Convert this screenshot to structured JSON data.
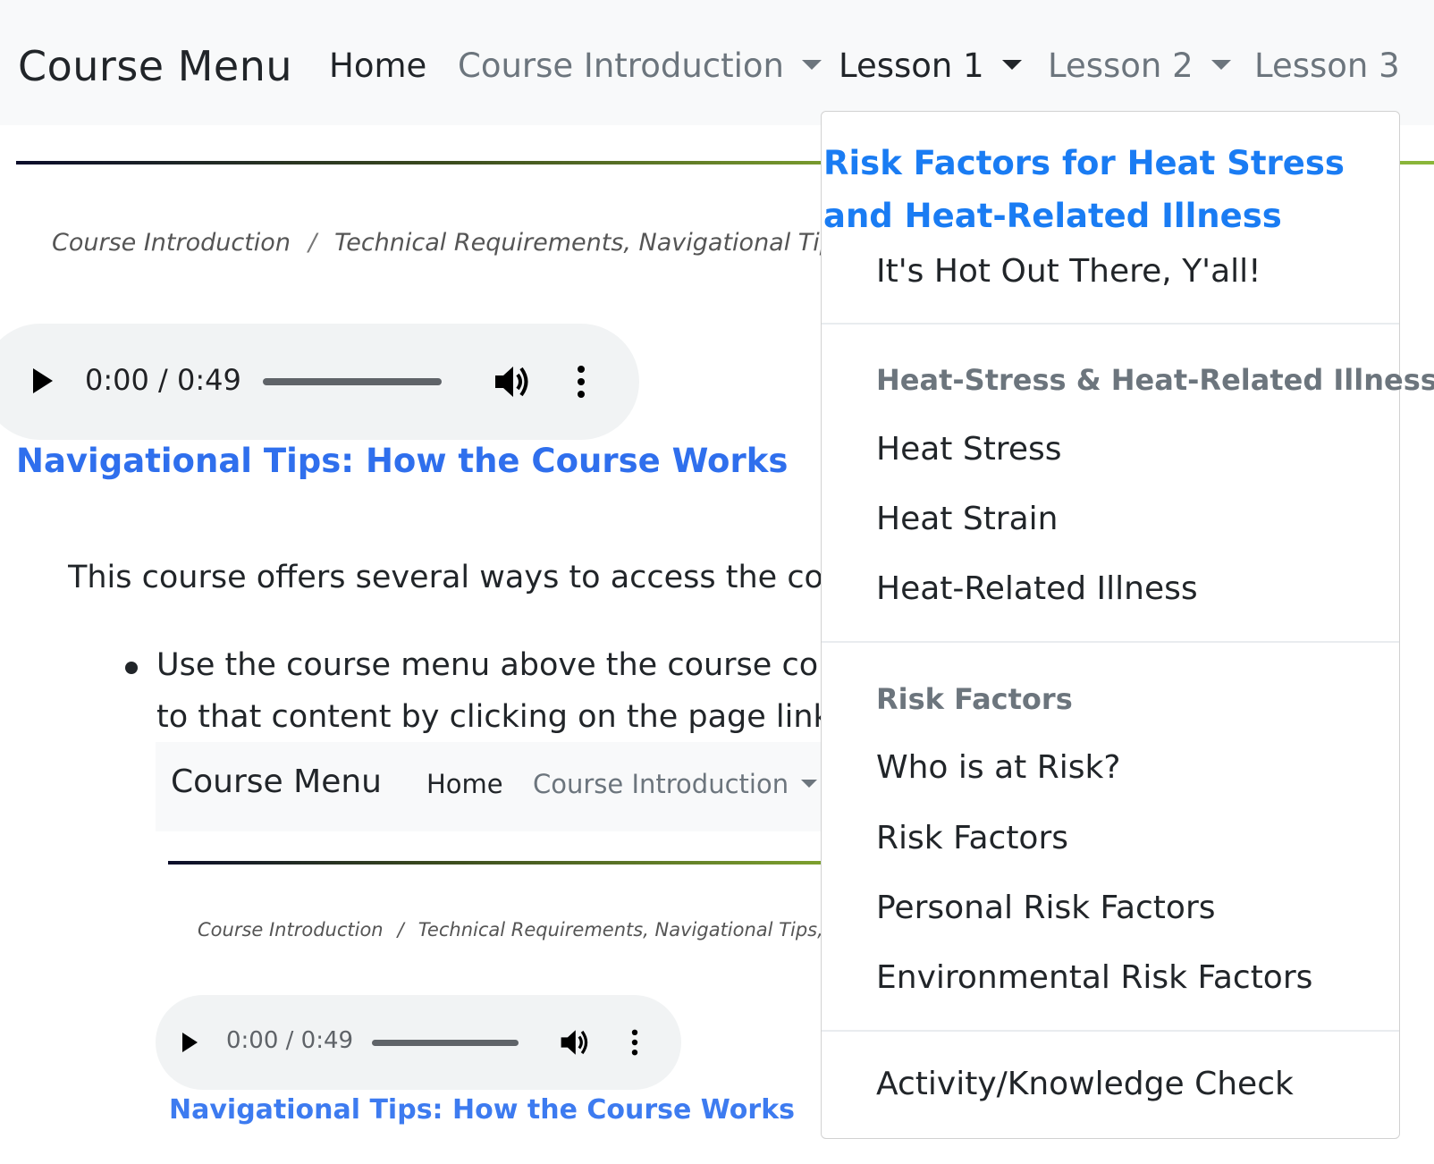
{
  "navbar": {
    "brand": "Course Menu",
    "links": {
      "home": "Home",
      "course_intro": "Course Introduction",
      "lesson1": "Lesson 1",
      "lesson2": "Lesson 2",
      "lesson3": "Lesson 3"
    }
  },
  "breadcrumb": {
    "items": [
      "Course Introduction",
      "Technical Requirements, Navigational Tips, and A"
    ],
    "separator": "/"
  },
  "audio": {
    "time": "0:00 / 0:49"
  },
  "content": {
    "heading": "Navigational Tips: How the Course Works",
    "paragraph": "This course offers several ways to access the cour",
    "bullet_lines": [
      "Use the course menu above the course con",
      "to that content by clicking on the page link."
    ]
  },
  "embedded_screenshot": {
    "brand": "Course Menu",
    "home": "Home",
    "course_intro": "Course Introduction",
    "breadcrumb": [
      "Course Introduction",
      "Technical Requirements, Navigational Tips, and"
    ],
    "separator": "/",
    "audio_time": "0:00 / 0:49",
    "heading": "Navigational Tips: How the Course Works"
  },
  "dropdown": {
    "active_item": "Risk Factors for Heat Stress and Heat-Related Illness",
    "intro_item": "It's Hot Out There, Y'all!",
    "section1": {
      "header": "Heat-Stress & Heat-Related Illness",
      "items": [
        "Heat Stress",
        "Heat Strain",
        "Heat-Related Illness"
      ]
    },
    "section2": {
      "header": "Risk Factors",
      "items": [
        "Who is at Risk?",
        "Risk Factors",
        "Personal Risk Factors",
        "Environmental Risk Factors"
      ]
    },
    "final_item": "Activity/Knowledge Check"
  },
  "colors": {
    "link_blue": "#2f6fed",
    "active_blue": "#1a7cf3",
    "muted_gray": "#6c757d",
    "navbar_bg": "#f8f9fa"
  },
  "icons": [
    "play-icon",
    "volume-icon",
    "more-vert-icon",
    "caret-down-icon"
  ]
}
